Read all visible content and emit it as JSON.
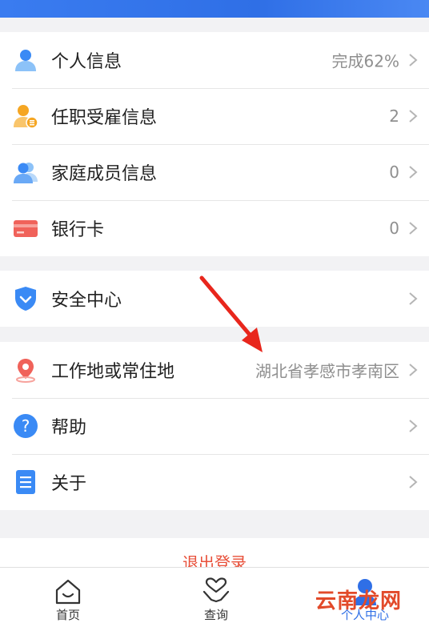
{
  "profile_section": {
    "items": [
      {
        "label": "个人信息",
        "value": "完成62%",
        "icon": "person-icon"
      },
      {
        "label": "任职受雇信息",
        "value": "2",
        "icon": "employee-badge-icon"
      },
      {
        "label": "家庭成员信息",
        "value": "0",
        "icon": "family-members-icon"
      },
      {
        "label": "银行卡",
        "value": "0",
        "icon": "bank-card-icon"
      }
    ]
  },
  "security_section": {
    "items": [
      {
        "label": "安全中心",
        "value": "",
        "icon": "shield-icon"
      }
    ]
  },
  "other_section": {
    "items": [
      {
        "label": "工作地或常住地",
        "value": "湖北省孝感市孝南区",
        "icon": "location-pin-icon"
      },
      {
        "label": "帮助",
        "value": "",
        "icon": "help-icon"
      },
      {
        "label": "关于",
        "value": "",
        "icon": "document-icon"
      }
    ]
  },
  "logout": {
    "label": "退出登录"
  },
  "tabbar": {
    "tabs": [
      {
        "label": "首页",
        "icon": "home-icon"
      },
      {
        "label": "查询",
        "icon": "heart-hand-icon"
      },
      {
        "label": "个人中心",
        "icon": "user-icon"
      }
    ]
  },
  "watermark": {
    "text": "云南龙网"
  },
  "colors": {
    "brand_blue": "#2f6fe6",
    "logout_red": "#e8503a",
    "value_gray": "#8f8f8f",
    "annotation_red": "#e8261c"
  }
}
